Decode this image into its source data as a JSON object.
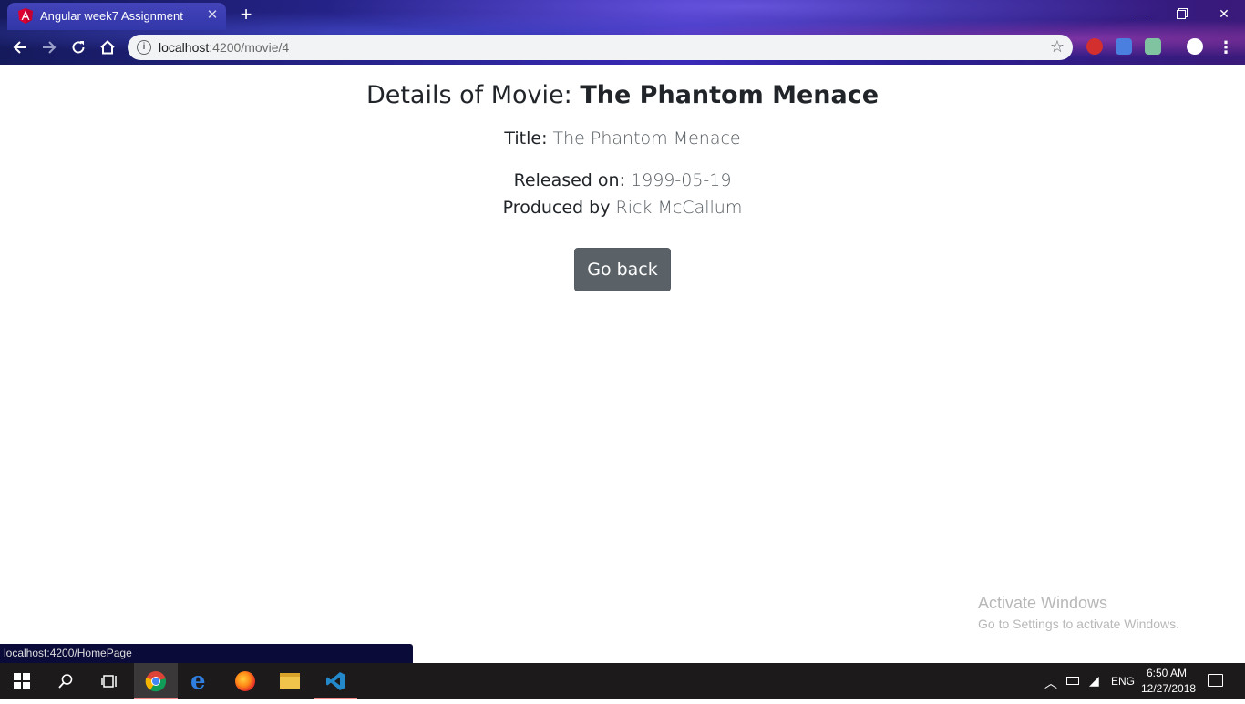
{
  "browser": {
    "tab_title": "Angular week7 Assignment",
    "url_host": "localhost",
    "url_path": ":4200/movie/4"
  },
  "page": {
    "heading_prefix": "Details of Movie: ",
    "heading_movie": "The Phantom Menace",
    "title_label": "Title: ",
    "title_value": "The Phantom Menace",
    "released_label": "Released on: ",
    "released_value": "1999-05-19",
    "producer_label": "Produced by ",
    "producer_value": "Rick McCallum",
    "back_button": "Go back"
  },
  "watermark": {
    "title": "Activate Windows",
    "subtitle": "Go to Settings to activate Windows."
  },
  "status_bar": {
    "link": "localhost:4200/HomePage"
  },
  "taskbar": {
    "language": "ENG",
    "time": "6:50 AM",
    "date": "12/27/2018"
  },
  "colors": {
    "button_bg": "#5a6268",
    "text": "#212529",
    "muted": "#555b60"
  }
}
